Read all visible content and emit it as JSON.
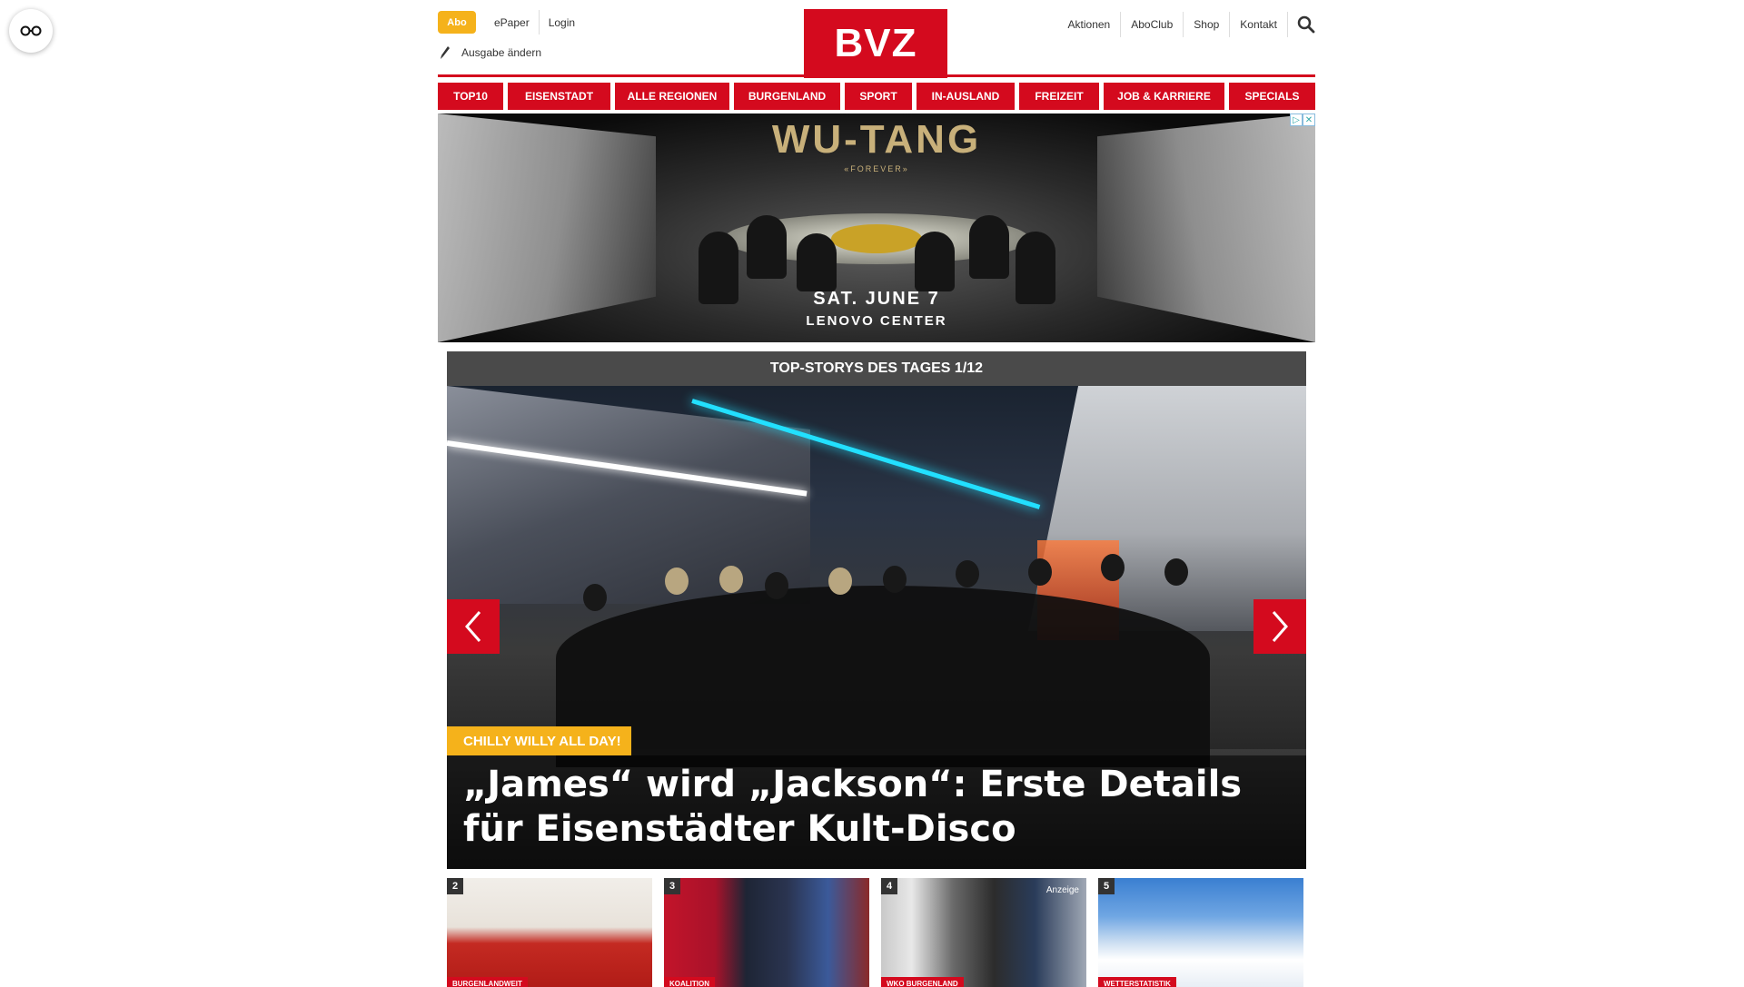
{
  "accessibility": {
    "icon": "accessibility-glasses-icon"
  },
  "header": {
    "abo_label": "Abo",
    "links_left": [
      "ePaper",
      "Login"
    ],
    "edition_label": "Ausgabe ändern",
    "logo_text": "BVZ",
    "links_right": [
      "Aktionen",
      "AboClub",
      "Shop",
      "Kontakt"
    ],
    "search_icon": "search-icon"
  },
  "nav": [
    "TOP10",
    "EISENSTADT",
    "ALLE REGIONEN",
    "BURGENLAND",
    "SPORT",
    "IN-AUSLAND",
    "FREIZEIT",
    "JOB & KARRIERE",
    "SPECIALS"
  ],
  "ad": {
    "title": "WU-TANG",
    "subtitle": "«FOREVER»",
    "date": "SAT. JUNE 7",
    "venue": "LENOVO CENTER"
  },
  "stories": {
    "heading": "TOP-STORYS DES TAGES 1/12",
    "hero_tag": "CHILLY WILLY ALL DAY!",
    "hero_title": "„James“ wird „Jackson“: Erste Details für Eisenstädter Kult-Disco",
    "thumbs": [
      {
        "num": "2",
        "tag": "BURGENLANDWEIT",
        "badge": ""
      },
      {
        "num": "3",
        "tag": "KOALITION",
        "badge": ""
      },
      {
        "num": "4",
        "tag": "WKO BURGENLAND",
        "badge": "Anzeige"
      },
      {
        "num": "5",
        "tag": "WETTERSTATISTIK",
        "badge": ""
      }
    ]
  },
  "colors": {
    "brand_red": "#d40a1e",
    "accent_yellow": "#f5b21b",
    "bar_gray": "#4a4a4a"
  }
}
